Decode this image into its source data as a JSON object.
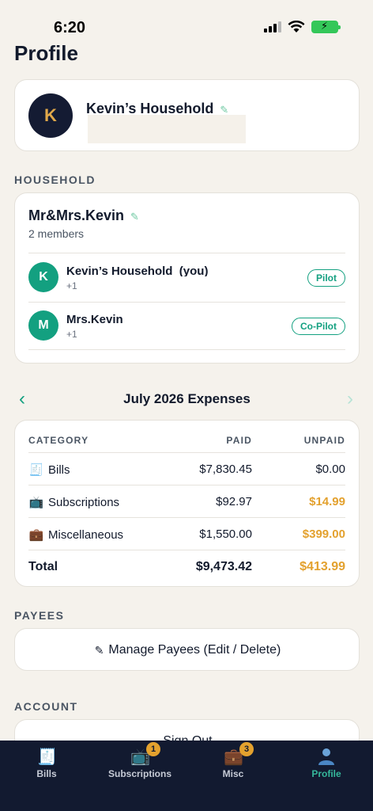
{
  "status_bar": {
    "time": "6:20"
  },
  "page": {
    "title": "Profile"
  },
  "profile": {
    "avatar_initial": "K",
    "name": "Kevin’s Household"
  },
  "household": {
    "section_label": "HOUSEHOLD",
    "name": "Mr&Mrs.Kevin",
    "member_count": "2 members",
    "members": [
      {
        "initial": "K",
        "name": "Kevin’s Household  (you)",
        "phone": "+1",
        "role": "Pilot"
      },
      {
        "initial": "M",
        "name": "Mrs.Kevin",
        "phone": "+1",
        "role": "Co-Pilot"
      }
    ]
  },
  "expenses": {
    "month_title": "July 2026 Expenses",
    "headers": {
      "category": "CATEGORY",
      "paid": "PAID",
      "unpaid": "UNPAID"
    },
    "rows": [
      {
        "icon": "receipt-icon",
        "category": "Bills",
        "paid": "$7,830.45",
        "unpaid": "$0.00"
      },
      {
        "icon": "tv-icon",
        "category": "Subscriptions",
        "paid": "$92.97",
        "unpaid": "$14.99"
      },
      {
        "icon": "briefcase-icon",
        "category": "Miscellaneous",
        "paid": "$1,550.00",
        "unpaid": "$399.00"
      }
    ],
    "total": {
      "label": "Total",
      "paid": "$9,473.42",
      "unpaid": "$413.99"
    }
  },
  "payees": {
    "section_label": "PAYEES",
    "manage_label": "Manage Payees (Edit / Delete)"
  },
  "account": {
    "section_label": "ACCOUNT",
    "sign_out_label": "Sign Out"
  },
  "tabs": [
    {
      "label": "Bills",
      "icon": "receipt-icon"
    },
    {
      "label": "Subscriptions",
      "icon": "tv-icon",
      "badge": "1"
    },
    {
      "label": "Misc",
      "icon": "briefcase-icon",
      "badge": "3"
    },
    {
      "label": "Profile",
      "icon": "person-icon",
      "active": true
    }
  ],
  "colors": {
    "accent": "#13a080",
    "owed": "#e3a12e",
    "tab_bar": "#121a30",
    "avatar_bg": "#141b33"
  }
}
